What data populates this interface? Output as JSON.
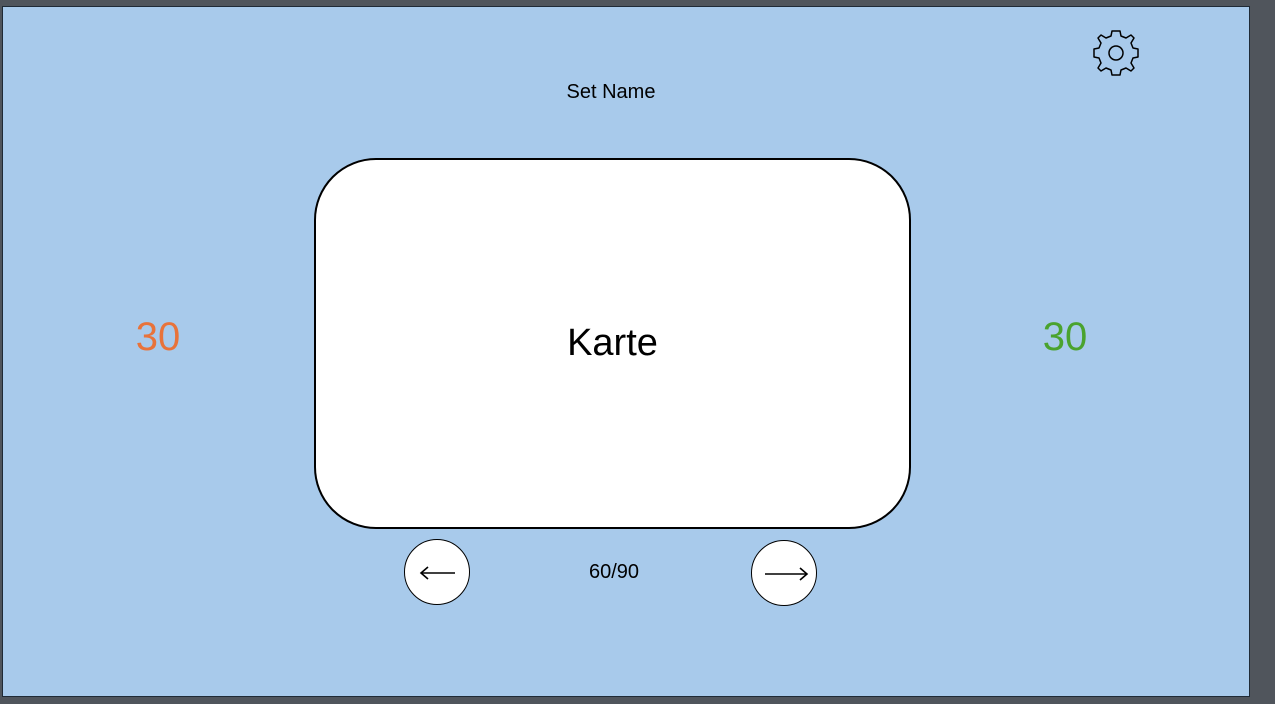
{
  "header": {
    "set_name": "Set Name"
  },
  "settings": {
    "icon": "gear-icon"
  },
  "scores": {
    "wrong": "30",
    "wrong_color": "#e8733a",
    "right": "30",
    "right_color": "#4aa32e"
  },
  "card": {
    "text": "Karte"
  },
  "navigation": {
    "prev_icon": "arrow-left-icon",
    "next_icon": "arrow-right-icon",
    "progress": "60/90"
  },
  "colors": {
    "background": "#a8caeb",
    "card": "#ffffff"
  }
}
